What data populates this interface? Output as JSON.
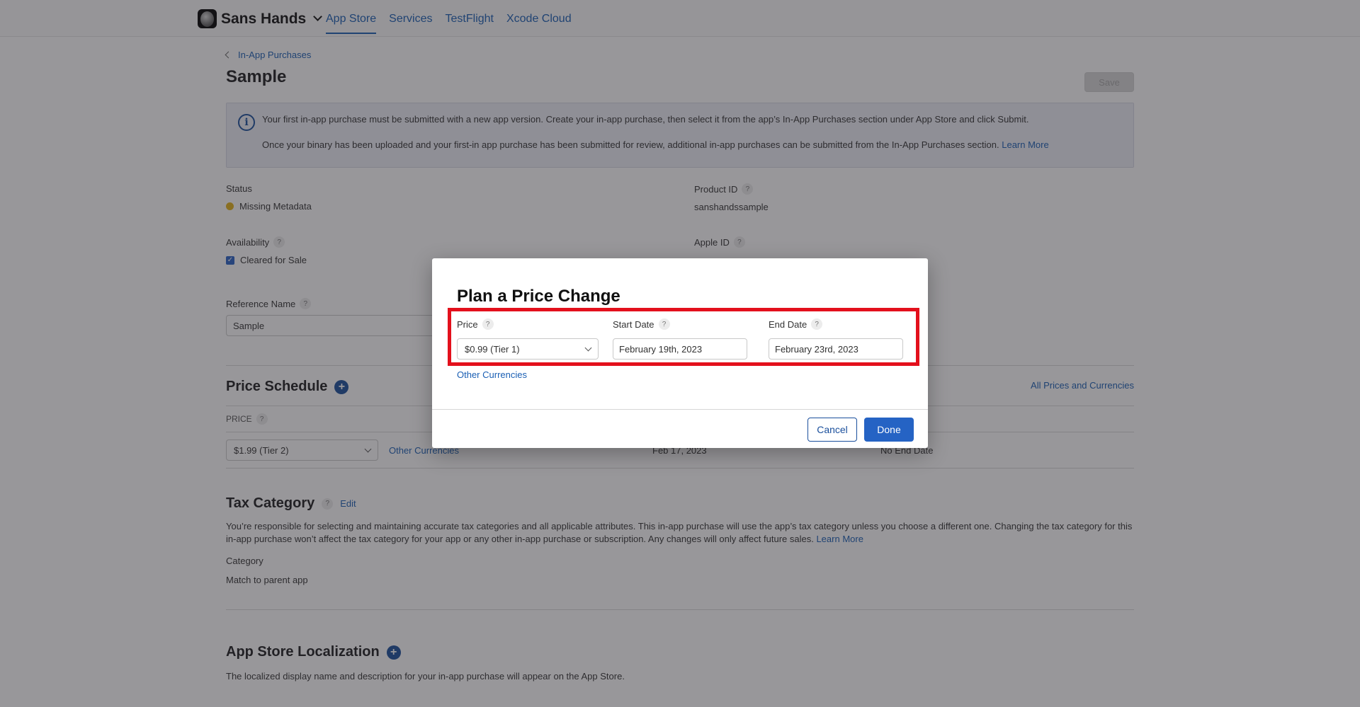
{
  "header": {
    "app_name": "Sans Hands",
    "nav": [
      {
        "label": "App Store",
        "active": true
      },
      {
        "label": "Services",
        "active": false
      },
      {
        "label": "TestFlight",
        "active": false
      },
      {
        "label": "Xcode Cloud",
        "active": false
      }
    ]
  },
  "breadcrumb": {
    "label": "In-App Purchases"
  },
  "page": {
    "title": "Sample",
    "save_label": "Save"
  },
  "info_box": {
    "line1": "Your first in-app purchase must be submitted with a new app version. Create your in-app purchase, then select it from the app’s In-App Purchases section under App Store and click Submit.",
    "line2": "Once your binary has been uploaded and your first-in app purchase has been submitted for review, additional in-app purchases can be submitted from the In-App Purchases section.",
    "learn_more": "Learn More"
  },
  "fields": {
    "status_label": "Status",
    "status_value": "Missing Metadata",
    "status_color": "#e3b219",
    "product_id_label": "Product ID",
    "product_id_value": "sanshandssample",
    "availability_label": "Availability",
    "availability_value": "Cleared for Sale",
    "availability_checked": true,
    "apple_id_label": "Apple ID",
    "reference_name_label": "Reference Name",
    "reference_name_value": "Sample"
  },
  "price_schedule": {
    "title": "Price Schedule",
    "all_prices_link": "All Prices and Currencies",
    "price_col": "PRICE",
    "row": {
      "price": "$1.99 (Tier 2)",
      "other_currencies": "Other Currencies",
      "start": "Feb 17, 2023",
      "end": "No End Date"
    }
  },
  "tax": {
    "title": "Tax Category",
    "edit": "Edit",
    "description": "You’re responsible for selecting and maintaining accurate tax categories and all applicable attributes. This in-app purchase will use the app’s tax category unless you choose a different one. Changing the tax category for this in-app purchase won’t affect the tax category for your app or any other in-app purchase or subscription. Any changes will only affect future sales.",
    "learn_more": "Learn More",
    "category_label": "Category",
    "category_value": "Match to parent app"
  },
  "localization": {
    "title": "App Store Localization",
    "description": "The localized display name and description for your in-app purchase will appear on the App Store."
  },
  "modal": {
    "title": "Plan a Price Change",
    "price_label": "Price",
    "price_value": "$0.99 (Tier 1)",
    "start_label": "Start Date",
    "start_value": "February 19th, 2023",
    "end_label": "End Date",
    "end_value": "February 23rd, 2023",
    "other_currencies": "Other Currencies",
    "cancel": "Cancel",
    "done": "Done"
  },
  "colors": {
    "accent": "#1a5fb4",
    "primary_button": "#2563c4",
    "highlight": "#e3101c"
  }
}
